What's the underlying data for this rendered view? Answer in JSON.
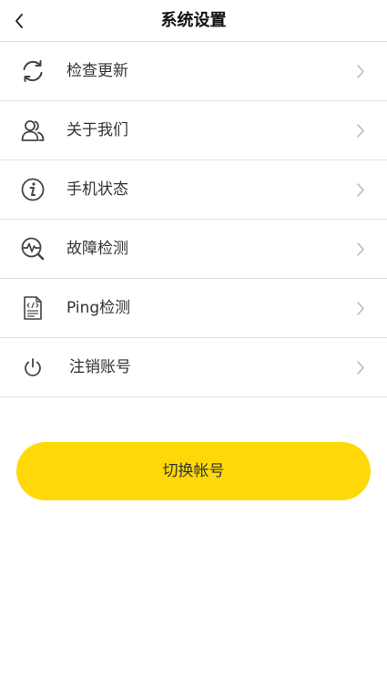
{
  "header": {
    "title": "系统设置",
    "back_icon": "chevron-left-icon"
  },
  "menu": {
    "items": [
      {
        "label": "检查更新",
        "icon": "refresh-icon"
      },
      {
        "label": "关于我们",
        "icon": "users-icon"
      },
      {
        "label": "手机状态",
        "icon": "info-icon"
      },
      {
        "label": "故障检测",
        "icon": "diagnostics-icon"
      },
      {
        "label": "Ping检测",
        "icon": "code-document-icon"
      },
      {
        "label": "注销账号",
        "icon": "power-icon"
      }
    ],
    "chevron_icon": "chevron-right-icon"
  },
  "switch_button": {
    "label": "切换帐号",
    "color": "#ffd907"
  }
}
